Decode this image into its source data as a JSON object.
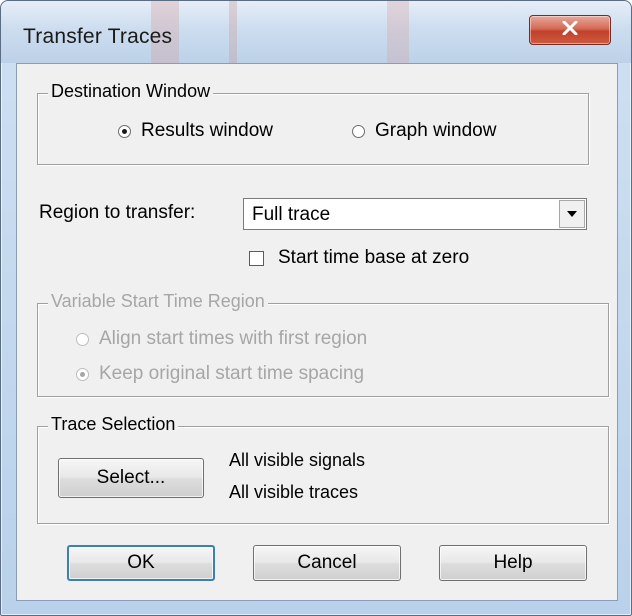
{
  "window": {
    "title": "Transfer Traces"
  },
  "destination": {
    "label": "Destination Window",
    "options": [
      "Results window",
      "Graph window"
    ],
    "selected": "Results window"
  },
  "region": {
    "label": "Region to transfer:",
    "value": "Full trace",
    "start_zero_label": "Start time base at zero",
    "start_zero_checked": false
  },
  "variable_start": {
    "label": "Variable Start Time Region",
    "enabled": false,
    "options": [
      "Align start times with first region",
      "Keep original start time spacing"
    ],
    "selected": "Keep original start time spacing"
  },
  "trace_selection": {
    "label": "Trace Selection",
    "select_button": "Select...",
    "info_lines": [
      "All visible signals",
      "All visible traces"
    ]
  },
  "buttons": {
    "ok": "OK",
    "cancel": "Cancel",
    "help": "Help"
  },
  "icons": {
    "close": "close-icon",
    "dropdown": "chevron-down-icon"
  }
}
